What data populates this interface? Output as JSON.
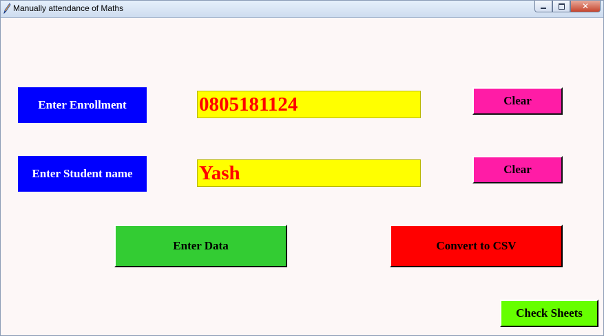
{
  "window": {
    "title": "Manually attendance of Maths",
    "controls": {
      "minimize_icon": "minimize-icon",
      "maximize_icon": "maximize-icon",
      "close_icon": "close-icon",
      "close_glyph": "✕"
    }
  },
  "form": {
    "enrollment": {
      "label": "Enter Enrollment",
      "value": "0805181124",
      "clear_label": "Clear"
    },
    "student_name": {
      "label": "Enter Student name",
      "value": "Yash",
      "clear_label": "Clear"
    }
  },
  "actions": {
    "enter_data_label": "Enter Data",
    "convert_csv_label": "Convert to CSV",
    "check_sheets_label": "Check Sheets"
  },
  "colors": {
    "background": "#fdf7f7",
    "label_bg": "#0000ff",
    "entry_bg": "#ffff00",
    "entry_text": "#ff0000",
    "clear_bg": "#ff1ca6",
    "enter_data_bg": "#33cc33",
    "convert_bg": "#ff0000",
    "check_sheets_bg": "#66ff00"
  }
}
